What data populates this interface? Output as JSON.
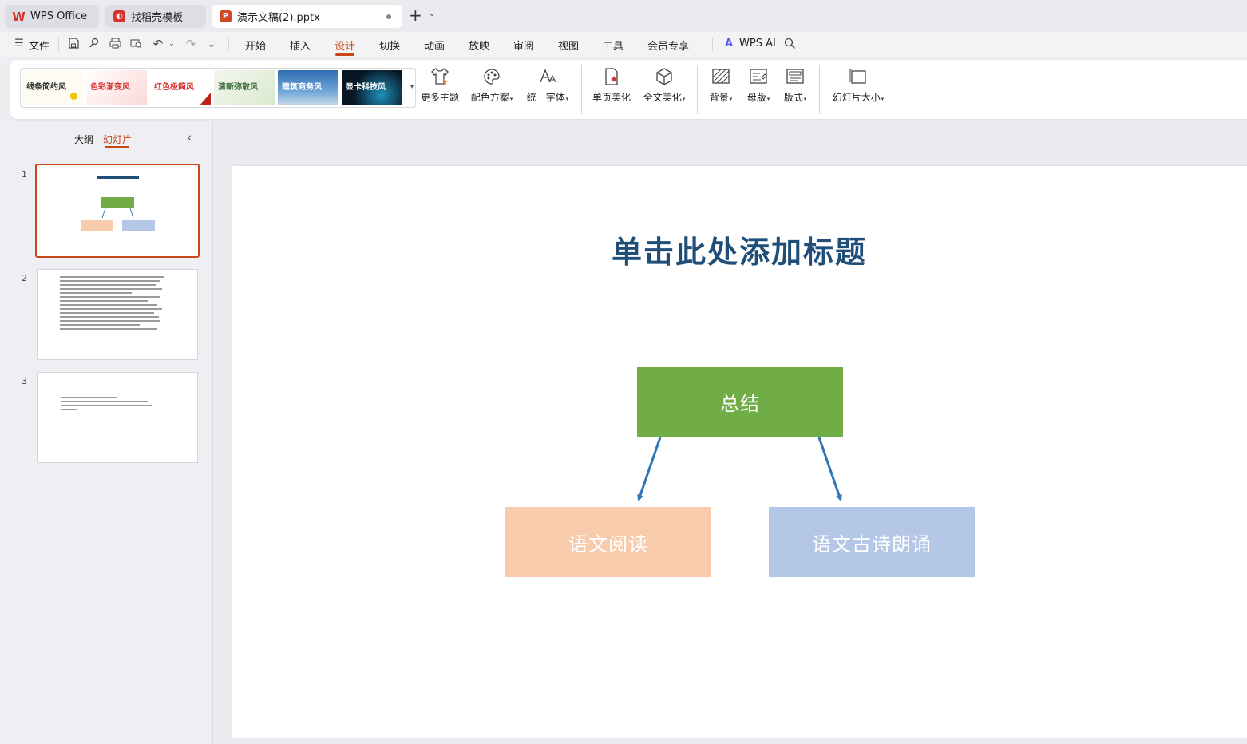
{
  "tabs": [
    {
      "label": "WPS Office",
      "icon": "wps-logo-icon"
    },
    {
      "label": "找稻壳模板",
      "icon": "docer-icon"
    },
    {
      "label": "演示文稿(2).pptx",
      "icon": "presentation-file-icon"
    }
  ],
  "menu": {
    "file_label": "文件",
    "items": [
      "开始",
      "插入",
      "设计",
      "切换",
      "动画",
      "放映",
      "审阅",
      "视图",
      "工具",
      "会员专享"
    ],
    "active": "设计",
    "wps_ai_label": "WPS AI"
  },
  "ribbon": {
    "themes": [
      {
        "label": "线条简约风",
        "color": "#333333",
        "bg": "#fdfbf2"
      },
      {
        "label": "色彩渐变风",
        "color": "#d7312b",
        "bg": "#fdeeee"
      },
      {
        "label": "红色极简风",
        "color": "#d7312b",
        "bg": "#ffffff"
      },
      {
        "label": "清新弥散风",
        "color": "#3a6b3a",
        "bg": "#eef3e6"
      },
      {
        "label": "建筑商务风",
        "color": "#ffffff",
        "bg": "#3d78b8"
      },
      {
        "label": "显卡科技风",
        "color": "#ffffff",
        "bg": "#0b1b2b"
      }
    ],
    "buttons": {
      "more_themes": "更多主题",
      "color_scheme": "配色方案",
      "unify_font": "统一字体",
      "page_beautify": "单页美化",
      "full_beautify": "全文美化",
      "background": "背景",
      "master": "母版",
      "layout": "版式",
      "slide_size": "幻灯片大小"
    }
  },
  "left_panel": {
    "outline_tab": "大纲",
    "slides_tab": "幻灯片",
    "slide_numbers": [
      "1",
      "2",
      "3"
    ]
  },
  "slide": {
    "title": "单击此处添加标题",
    "summary_box": "总结",
    "left_box": "语文阅读",
    "right_box": "语文古诗朗诵",
    "colors": {
      "title": "#1f4e79",
      "summary": "#70ad47",
      "left": "#f7cbac",
      "right": "#b4c7e7",
      "arrow": "#2e75b6"
    }
  }
}
